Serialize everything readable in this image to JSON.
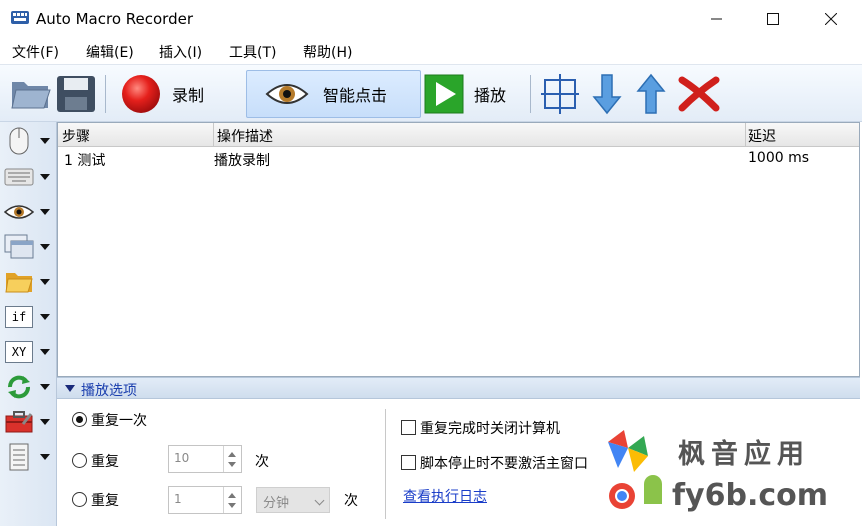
{
  "window": {
    "title": "Auto Macro Recorder",
    "controls": {
      "minimize": "—",
      "maximize": "☐",
      "close": "✕"
    }
  },
  "menu": [
    "文件(F)",
    "编辑(E)",
    "插入(I)",
    "工具(T)",
    "帮助(H)"
  ],
  "toolbar": {
    "open_icon": "folder-open-icon",
    "save_icon": "save-icon",
    "record_label": "录制",
    "smart_click_label": "智能点击",
    "play_label": "播放",
    "select_icon": "select-region-icon",
    "move_down_icon": "arrow-down-icon",
    "move_up_icon": "arrow-up-icon",
    "delete_icon": "delete-x-icon"
  },
  "left_tools": [
    "mouse-icon",
    "keyboard-icon",
    "eye-icon",
    "window-icon",
    "folder-icon",
    "if",
    "XY",
    "loop-icon",
    "toolbox-icon",
    "list-icon"
  ],
  "table": {
    "columns": [
      "步骤",
      "操作描述",
      "延迟"
    ],
    "rows": [
      {
        "step": "1  测试",
        "desc": "播放录制",
        "delay": "1000 ms"
      }
    ]
  },
  "playback": {
    "title": "播放选项",
    "repeat_once": "重复一次",
    "repeat": "重复",
    "repeat_times_value": "10",
    "times_unit": "次",
    "repeat2": "重复",
    "interval_value": "1",
    "interval_unit_selected": "分钟",
    "times_unit2": "次",
    "shutdown_label": "重复完成时关闭计算机",
    "no_activate_label": "脚本停止时不要激活主窗口",
    "log_link": "查看执行日志"
  },
  "watermark": {
    "line1": "枫音应用",
    "line2": "fy6b.com"
  },
  "colors": {
    "accent": "#1b3fae",
    "record": "#d11a1a",
    "play": "#2aa52a",
    "delete": "#d0201c",
    "arrow": "#4a8fd6"
  }
}
